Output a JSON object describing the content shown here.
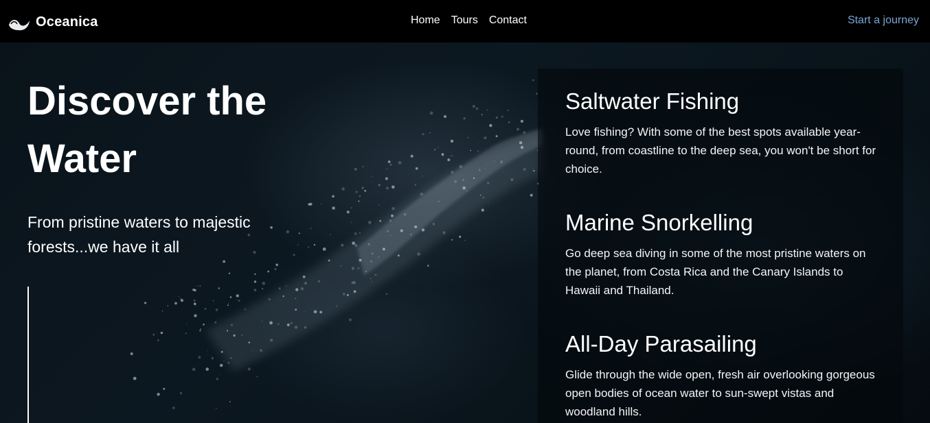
{
  "nav": {
    "brand_name": "Oceanica",
    "brand_icon": "wave-icon",
    "links": [
      "Home",
      "Tours",
      "Contact"
    ],
    "cta": "Start a journey"
  },
  "hero": {
    "headline": "Discover the Water",
    "subhead": "From pristine waters to majestic forests...we have it all"
  },
  "features": [
    {
      "title": "Saltwater Fishing",
      "description": "Love fishing? With some of the best spots available year-round, from coastline to the deep sea, you won't be short for choice."
    },
    {
      "title": "Marine Snorkelling",
      "description": "Go deep sea diving in some of the most pristine waters on the planet, from Costa Rica and the Canary Islands to Hawaii and Thailand."
    },
    {
      "title": "All-Day Parasailing",
      "description": "Glide through the wide open, fresh air overlooking gorgeous open bodies of ocean water to sun-swept vistas and woodland hills."
    }
  ],
  "colors": {
    "nav_background": "#000000",
    "cta": "#7aa6d6",
    "text": "#ffffff"
  }
}
